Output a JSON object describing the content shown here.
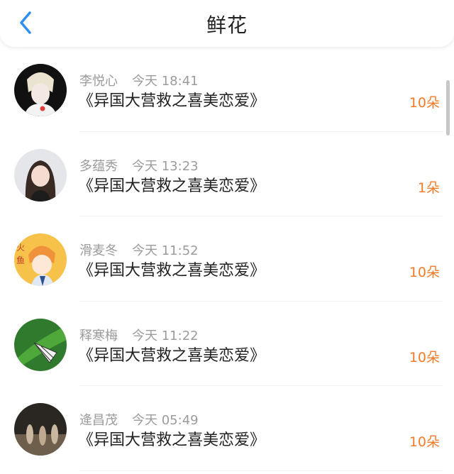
{
  "header": {
    "title": "鲜花"
  },
  "items": [
    {
      "name": "李悦心",
      "time": "今天 18:41",
      "work": "《异国大营救之喜美恋爱》",
      "count": "10朵"
    },
    {
      "name": "多蕴秀",
      "time": "今天 13:23",
      "work": "《异国大营救之喜美恋爱》",
      "count": "1朵"
    },
    {
      "name": "滑麦冬",
      "time": "今天 11:52",
      "work": "《异国大营救之喜美恋爱》",
      "count": "10朵"
    },
    {
      "name": "释寒梅",
      "time": "今天 11:22",
      "work": "《异国大营救之喜美恋爱》",
      "count": "10朵"
    },
    {
      "name": "逄昌茂",
      "time": "今天 05:49",
      "work": "《异国大营救之喜美恋爱》",
      "count": "10朵"
    }
  ],
  "colors": {
    "accent": "#f47b2a",
    "back": "#2e8ff0"
  }
}
